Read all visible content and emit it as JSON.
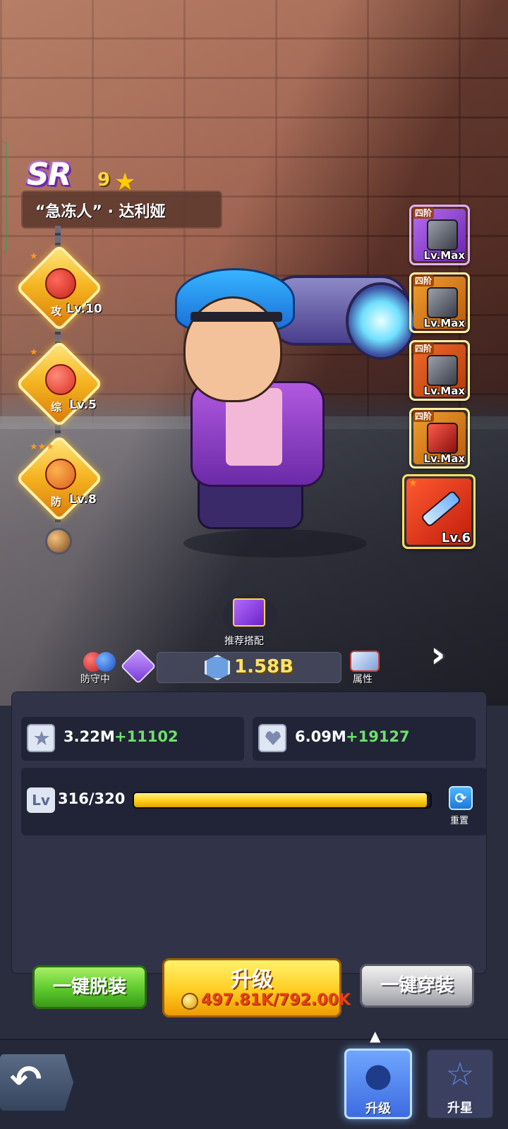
{
  "hero": {
    "rarity": "SR",
    "stars": "9",
    "name": "“急冻人” · 达利娅"
  },
  "skills": [
    {
      "tag": "攻",
      "level": "Lv.10",
      "stars": 1
    },
    {
      "tag": "综",
      "level": "Lv.5",
      "stars": 1
    },
    {
      "tag": "防",
      "level": "Lv.8",
      "stars": 3
    }
  ],
  "equipment": [
    {
      "grade": "四阶",
      "level": "Lv.Max",
      "color": "#8a3cc8"
    },
    {
      "grade": "四阶",
      "level": "Lv.Max",
      "color": "#c66a12"
    },
    {
      "grade": "四阶",
      "level": "Lv.Max",
      "color": "#c94a12"
    },
    {
      "grade": "四阶",
      "level": "Lv.Max",
      "color": "#c66a12"
    },
    {
      "grade": "",
      "level": "Lv.6",
      "color": "#d6321a"
    }
  ],
  "recommend_label": "推荐搭配",
  "defense_status": "防守中",
  "power": "1.58B",
  "attribute_label": "属性",
  "stats": {
    "attack": {
      "value": "3.22M",
      "increase": "+11102"
    },
    "health": {
      "value": "6.09M",
      "increase": "+19127"
    }
  },
  "level": {
    "icon": "Lv",
    "current": "316/320",
    "progress": 0.9875,
    "reset_label": "重置"
  },
  "buttons": {
    "unequip_all": "一键脱装",
    "upgrade": "升级",
    "upgrade_cost": "497.81K/792.00K",
    "equip_all": "一键穿装"
  },
  "tabs": {
    "upgrade": "升级",
    "star": "升星"
  },
  "icons": {
    "back": "undo-arrow-icon",
    "next": "chevron-right-icon",
    "star": "star-icon",
    "reset": "refresh-icon"
  }
}
